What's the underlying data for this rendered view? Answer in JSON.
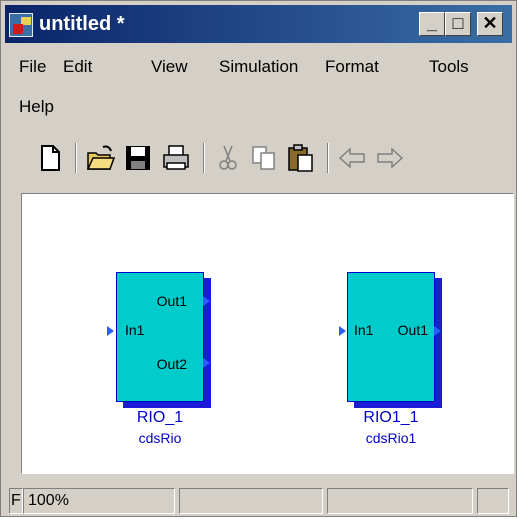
{
  "window": {
    "title": "untitled *",
    "minimize_label": "_",
    "restore_label": "□",
    "close_label": "✕"
  },
  "menubar": {
    "items": [
      "File",
      "Edit",
      "View",
      "Simulation",
      "Format",
      "Tools",
      "Help"
    ]
  },
  "toolbar": {
    "icons": [
      "new-document-icon",
      "open-folder-icon",
      "save-disk-icon",
      "print-icon",
      "cut-icon",
      "copy-icon",
      "paste-icon",
      "back-arrow-icon",
      "forward-arrow-icon"
    ]
  },
  "canvas": {
    "blocks": [
      {
        "in_ports": [
          "In1"
        ],
        "out_ports": [
          "Out1",
          "Out2"
        ],
        "name": "RIO_1",
        "library": "cdsRio"
      },
      {
        "in_ports": [
          "In1"
        ],
        "out_ports": [
          "Out1"
        ],
        "name": "RIO1_1",
        "library": "cdsRio1"
      }
    ],
    "colors": {
      "block_fill": "#00cccc",
      "block_shadow": "#1b1bd8",
      "label": "#0000cc"
    }
  },
  "statusbar": {
    "panes": [
      "F",
      "100%",
      "",
      "",
      ""
    ]
  },
  "colors": {
    "titlebar": "#0a246a",
    "chrome": "#d4d0c8"
  }
}
